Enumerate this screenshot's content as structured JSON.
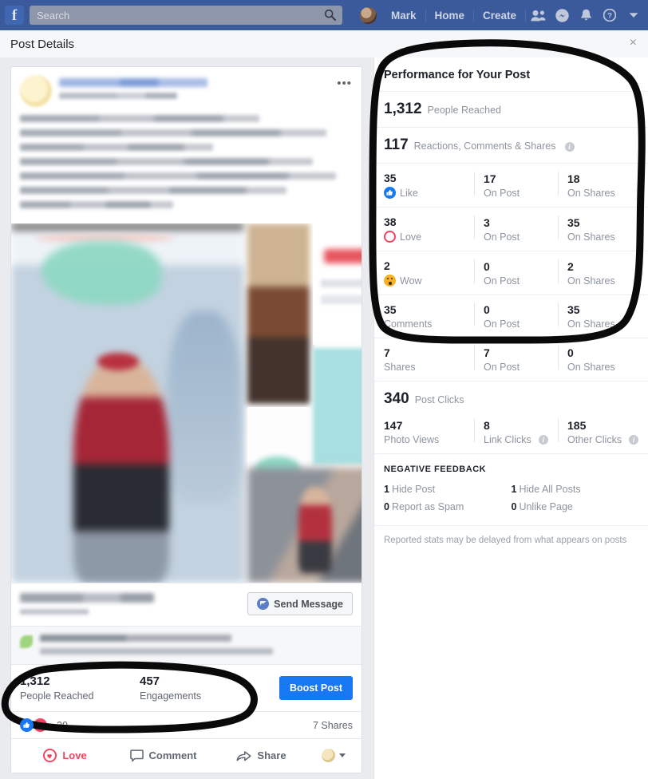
{
  "nav": {
    "logo": "f",
    "search_placeholder": "Search",
    "search_value": "",
    "user_name": "Mark",
    "home_label": "Home",
    "create_label": "Create",
    "icons": [
      "friend-requests-icon",
      "messenger-icon",
      "notifications-icon",
      "help-icon",
      "account-menu-caret-icon"
    ]
  },
  "header": {
    "title": "Post Details",
    "close_label": "×"
  },
  "post": {
    "menu_label": "•••",
    "send_message_label": "Send Message",
    "insights": {
      "reach_value": "1,312",
      "reach_label": "People Reached",
      "engagements_value": "457",
      "engagements_label": "Engagements",
      "boost_label": "Boost Post"
    },
    "reactions_count": "20",
    "shares_text": "7 Shares",
    "actions": {
      "love": "Love",
      "comment": "Comment",
      "share": "Share"
    }
  },
  "performance": {
    "title": "Performance for Your Post",
    "reach": {
      "value": "1,312",
      "label": "People Reached"
    },
    "engagement": {
      "value": "117",
      "label": "Reactions, Comments & Shares",
      "has_info": true
    },
    "breakdown": [
      {
        "value": "35",
        "label": "Like",
        "icon": "like-icon",
        "on_post": "17",
        "on_post_label": "On Post",
        "on_shares": "18",
        "on_shares_label": "On Shares"
      },
      {
        "value": "38",
        "label": "Love",
        "icon": "love-icon",
        "on_post": "3",
        "on_post_label": "On Post",
        "on_shares": "35",
        "on_shares_label": "On Shares"
      },
      {
        "value": "2",
        "label": "Wow",
        "icon": "wow-icon",
        "on_post": "0",
        "on_post_label": "On Post",
        "on_shares": "2",
        "on_shares_label": "On Shares"
      },
      {
        "value": "35",
        "label": "Comments",
        "icon": null,
        "on_post": "0",
        "on_post_label": "On Post",
        "on_shares": "35",
        "on_shares_label": "On Shares"
      },
      {
        "value": "7",
        "label": "Shares",
        "icon": null,
        "on_post": "7",
        "on_post_label": "On Post",
        "on_shares": "0",
        "on_shares_label": "On Shares"
      }
    ],
    "clicks": {
      "value": "340",
      "label": "Post Clicks"
    },
    "clicks_breakdown": [
      {
        "value": "147",
        "label": "Photo Views",
        "has_info": false
      },
      {
        "value": "8",
        "label": "Link Clicks",
        "has_info": true
      },
      {
        "value": "185",
        "label": "Other Clicks",
        "has_info": true
      }
    ],
    "negative_feedback": {
      "title": "NEGATIVE FEEDBACK",
      "items": [
        {
          "value": "1",
          "label": "Hide Post"
        },
        {
          "value": "1",
          "label": "Hide All Posts"
        },
        {
          "value": "0",
          "label": "Report as Spam"
        },
        {
          "value": "0",
          "label": "Unlike Page"
        }
      ]
    },
    "note": "Reported stats may be delayed from what appears on posts"
  },
  "colors": {
    "nav_blue": "#3b5a9b",
    "brand_blue": "#1877f2",
    "love_red": "#f3425f",
    "wow_yellow": "#f7b125",
    "annotation_black": "#0a0a0a"
  }
}
